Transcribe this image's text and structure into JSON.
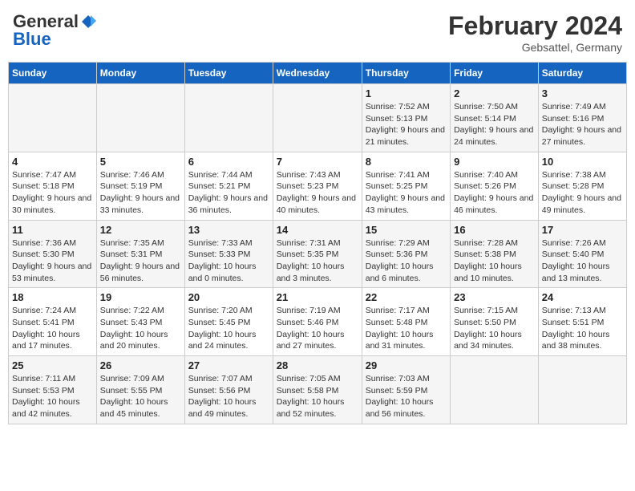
{
  "header": {
    "logo": {
      "general": "General",
      "blue": "Blue"
    },
    "title": "February 2024",
    "location": "Gebsattel, Germany"
  },
  "calendar": {
    "weekdays": [
      "Sunday",
      "Monday",
      "Tuesday",
      "Wednesday",
      "Thursday",
      "Friday",
      "Saturday"
    ],
    "weeks": [
      [
        {
          "day": null
        },
        {
          "day": null
        },
        {
          "day": null
        },
        {
          "day": null
        },
        {
          "day": 1,
          "sunrise": "7:52 AM",
          "sunset": "5:13 PM",
          "daylight": "9 hours and 21 minutes."
        },
        {
          "day": 2,
          "sunrise": "7:50 AM",
          "sunset": "5:14 PM",
          "daylight": "9 hours and 24 minutes."
        },
        {
          "day": 3,
          "sunrise": "7:49 AM",
          "sunset": "5:16 PM",
          "daylight": "9 hours and 27 minutes."
        }
      ],
      [
        {
          "day": 4,
          "sunrise": "7:47 AM",
          "sunset": "5:18 PM",
          "daylight": "9 hours and 30 minutes."
        },
        {
          "day": 5,
          "sunrise": "7:46 AM",
          "sunset": "5:19 PM",
          "daylight": "9 hours and 33 minutes."
        },
        {
          "day": 6,
          "sunrise": "7:44 AM",
          "sunset": "5:21 PM",
          "daylight": "9 hours and 36 minutes."
        },
        {
          "day": 7,
          "sunrise": "7:43 AM",
          "sunset": "5:23 PM",
          "daylight": "9 hours and 40 minutes."
        },
        {
          "day": 8,
          "sunrise": "7:41 AM",
          "sunset": "5:25 PM",
          "daylight": "9 hours and 43 minutes."
        },
        {
          "day": 9,
          "sunrise": "7:40 AM",
          "sunset": "5:26 PM",
          "daylight": "9 hours and 46 minutes."
        },
        {
          "day": 10,
          "sunrise": "7:38 AM",
          "sunset": "5:28 PM",
          "daylight": "9 hours and 49 minutes."
        }
      ],
      [
        {
          "day": 11,
          "sunrise": "7:36 AM",
          "sunset": "5:30 PM",
          "daylight": "9 hours and 53 minutes."
        },
        {
          "day": 12,
          "sunrise": "7:35 AM",
          "sunset": "5:31 PM",
          "daylight": "9 hours and 56 minutes."
        },
        {
          "day": 13,
          "sunrise": "7:33 AM",
          "sunset": "5:33 PM",
          "daylight": "10 hours and 0 minutes."
        },
        {
          "day": 14,
          "sunrise": "7:31 AM",
          "sunset": "5:35 PM",
          "daylight": "10 hours and 3 minutes."
        },
        {
          "day": 15,
          "sunrise": "7:29 AM",
          "sunset": "5:36 PM",
          "daylight": "10 hours and 6 minutes."
        },
        {
          "day": 16,
          "sunrise": "7:28 AM",
          "sunset": "5:38 PM",
          "daylight": "10 hours and 10 minutes."
        },
        {
          "day": 17,
          "sunrise": "7:26 AM",
          "sunset": "5:40 PM",
          "daylight": "10 hours and 13 minutes."
        }
      ],
      [
        {
          "day": 18,
          "sunrise": "7:24 AM",
          "sunset": "5:41 PM",
          "daylight": "10 hours and 17 minutes."
        },
        {
          "day": 19,
          "sunrise": "7:22 AM",
          "sunset": "5:43 PM",
          "daylight": "10 hours and 20 minutes."
        },
        {
          "day": 20,
          "sunrise": "7:20 AM",
          "sunset": "5:45 PM",
          "daylight": "10 hours and 24 minutes."
        },
        {
          "day": 21,
          "sunrise": "7:19 AM",
          "sunset": "5:46 PM",
          "daylight": "10 hours and 27 minutes."
        },
        {
          "day": 22,
          "sunrise": "7:17 AM",
          "sunset": "5:48 PM",
          "daylight": "10 hours and 31 minutes."
        },
        {
          "day": 23,
          "sunrise": "7:15 AM",
          "sunset": "5:50 PM",
          "daylight": "10 hours and 34 minutes."
        },
        {
          "day": 24,
          "sunrise": "7:13 AM",
          "sunset": "5:51 PM",
          "daylight": "10 hours and 38 minutes."
        }
      ],
      [
        {
          "day": 25,
          "sunrise": "7:11 AM",
          "sunset": "5:53 PM",
          "daylight": "10 hours and 42 minutes."
        },
        {
          "day": 26,
          "sunrise": "7:09 AM",
          "sunset": "5:55 PM",
          "daylight": "10 hours and 45 minutes."
        },
        {
          "day": 27,
          "sunrise": "7:07 AM",
          "sunset": "5:56 PM",
          "daylight": "10 hours and 49 minutes."
        },
        {
          "day": 28,
          "sunrise": "7:05 AM",
          "sunset": "5:58 PM",
          "daylight": "10 hours and 52 minutes."
        },
        {
          "day": 29,
          "sunrise": "7:03 AM",
          "sunset": "5:59 PM",
          "daylight": "10 hours and 56 minutes."
        },
        {
          "day": null
        },
        {
          "day": null
        }
      ]
    ]
  }
}
